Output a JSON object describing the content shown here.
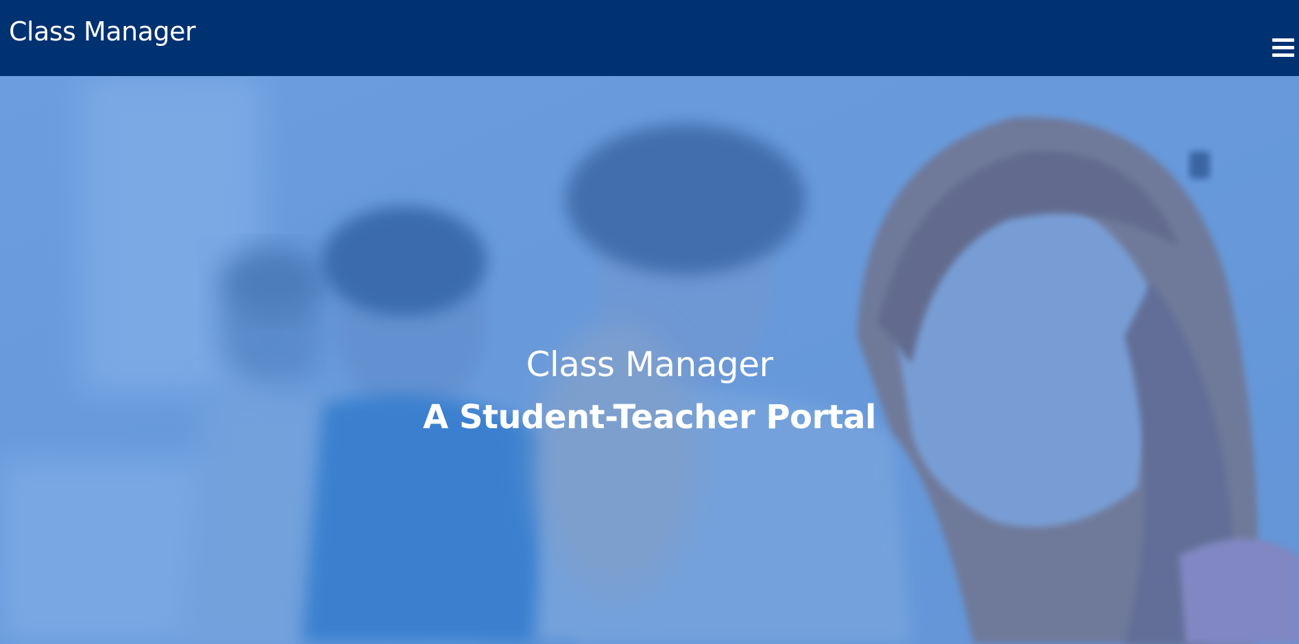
{
  "header": {
    "brand": "Class Manager",
    "menu_icon": "hamburger-menu-icon",
    "background_color": "#003171"
  },
  "hero": {
    "title": "Class Manager",
    "subtitle": "A Student-Teacher Portal",
    "overlay_color": "#6f9fdd",
    "image": "blurred-students-in-classroom-photo"
  }
}
